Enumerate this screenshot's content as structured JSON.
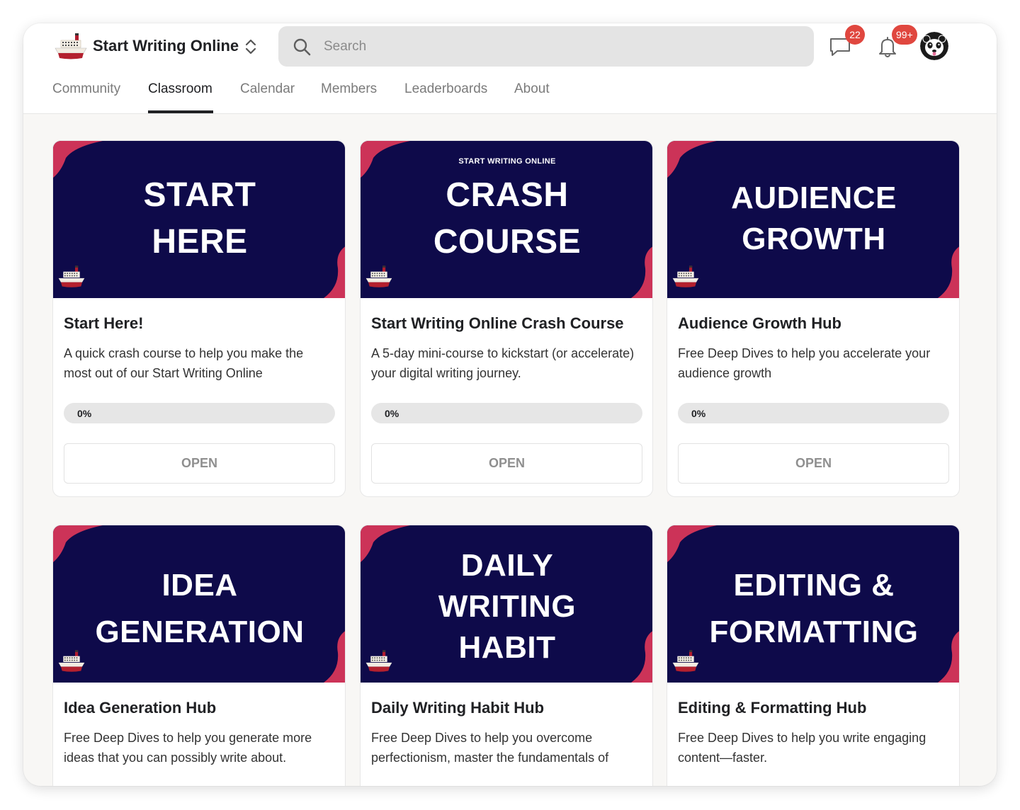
{
  "header": {
    "brand_name": "Start Writing Online",
    "search_placeholder": "Search",
    "chat_badge": "22",
    "notification_badge": "99+"
  },
  "nav": {
    "tabs": [
      {
        "label": "Community",
        "active": false
      },
      {
        "label": "Classroom",
        "active": true
      },
      {
        "label": "Calendar",
        "active": false
      },
      {
        "label": "Members",
        "active": false
      },
      {
        "label": "Leaderboards",
        "active": false
      },
      {
        "label": "About",
        "active": false
      }
    ]
  },
  "courses": [
    {
      "banner_kicker": "",
      "banner_lines": [
        "START",
        "HERE"
      ],
      "title": "Start Here!",
      "description": "A quick crash course to help you make the most out of our Start Writing Online",
      "progress": 0,
      "progress_label": "0%",
      "button_label": "OPEN"
    },
    {
      "banner_kicker": "START WRITING ONLINE",
      "banner_lines": [
        "CRASH",
        "COURSE"
      ],
      "title": "Start Writing Online Crash Course",
      "description": "A 5-day mini-course to kickstart (or accelerate) your digital writing journey.",
      "progress": 0,
      "progress_label": "0%",
      "button_label": "OPEN"
    },
    {
      "banner_kicker": "",
      "banner_lines": [
        "AUDIENCE",
        "GROWTH"
      ],
      "title": "Audience Growth Hub",
      "description": "Free Deep Dives to help you accelerate your audience growth",
      "progress": 0,
      "progress_label": "0%",
      "button_label": "OPEN"
    },
    {
      "banner_kicker": "",
      "banner_lines": [
        "IDEA",
        "GENERATION"
      ],
      "title": "Idea Generation Hub",
      "description": "Free Deep Dives to help you generate more ideas that you can possibly write about.",
      "progress": null,
      "progress_label": "",
      "button_label": ""
    },
    {
      "banner_kicker": "",
      "banner_lines": [
        "DAILY",
        "WRITING",
        "HABIT"
      ],
      "title": "Daily Writing Habit Hub",
      "description": "Free Deep Dives to help you overcome perfectionism, master the fundamentals of",
      "progress": null,
      "progress_label": "",
      "button_label": ""
    },
    {
      "banner_kicker": "",
      "banner_lines": [
        "EDITING &",
        "FORMATTING"
      ],
      "title": "Editing & Formatting Hub",
      "description": "Free Deep Dives to help you write engaging content—faster.",
      "progress": null,
      "progress_label": "",
      "button_label": ""
    }
  ],
  "colors": {
    "banner_bg": "#0e0a4a",
    "banner_accent": "#cc3358",
    "badge": "#e0473f",
    "active_tab": "#202124",
    "inactive_tab": "#7b7b7b"
  },
  "icons": {
    "logo": "ship-icon",
    "switcher": "chevron-up-down-icon",
    "search": "search-icon",
    "chat": "chat-bubble-icon",
    "notifications": "bell-icon",
    "avatar": "panda-avatar"
  }
}
